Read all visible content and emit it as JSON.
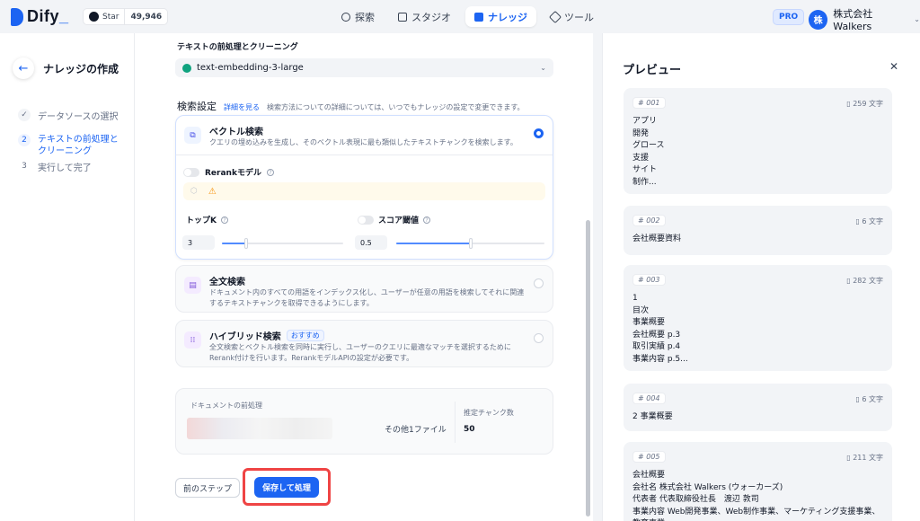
{
  "topbar": {
    "brand": "Dify",
    "github_label": "Star",
    "github_count": "49,946",
    "nav": [
      {
        "label": "探索",
        "icon": "compass-icon"
      },
      {
        "label": "スタジオ",
        "icon": "robot-icon"
      },
      {
        "label": "ナレッジ",
        "icon": "book-icon",
        "active": true
      },
      {
        "label": "ツール",
        "icon": "wrench-icon"
      }
    ],
    "plan_badge": "PRO",
    "avatar_initial": "株",
    "workspace_name": "株式会社Walkers"
  },
  "sidebar": {
    "title": "ナレッジの作成",
    "steps": [
      {
        "num": "✓",
        "label": "データソースの選択",
        "state": "done"
      },
      {
        "num": "2",
        "label": "テキストの前処理とクリーニング",
        "state": "active"
      },
      {
        "num": "3",
        "label": "実行して完了",
        "state": "pending"
      }
    ]
  },
  "main": {
    "section_heading": "テキストの前処理とクリーニング",
    "embedding_model": "text-embedding-3-large",
    "search": {
      "title": "検索設定",
      "link": "詳細を見る",
      "desc": "検索方法についての詳細については、いつでもナレッジの設定で変更できます。"
    },
    "vector": {
      "title": "ベクトル検索",
      "desc": "クエリの埋め込みを生成し、そのベクトル表現に最も類似したテキストチャンクを検索します。",
      "rerank_label": "Rerankモデル",
      "topk_label": "トップK",
      "topk_value": "3",
      "topk_fraction": 0.2,
      "score_label": "スコア閾値",
      "score_value": "0.5",
      "score_fraction": 0.5
    },
    "fulltext": {
      "title": "全文検索",
      "desc": "ドキュメント内のすべての用語をインデックス化し、ユーザーが任意の用語を検索してそれに関連するテキストチャンクを取得できるようにします。"
    },
    "hybrid": {
      "title": "ハイブリッド検索",
      "badge": "おすすめ",
      "desc": "全文検索とベクトル検索を同時に実行し、ユーザーのクエリに最適なマッチを選択するためにRerank付けを行います。RerankモデルAPIの設定が必要です。"
    },
    "preprocess": {
      "label": "ドキュメントの前処理",
      "other_files": "その他1ファイル",
      "chunk_label": "推定チャンク数",
      "chunk_value": "50"
    },
    "prev_button": "前のステップ",
    "save_button": "保存して処理"
  },
  "preview": {
    "title": "プレビュー",
    "chunks": [
      {
        "id": "001",
        "count": "259 文字",
        "text": "アプリ\n開発\nグロース\n支援\nサイト\n制作..."
      },
      {
        "id": "002",
        "count": "6 文字",
        "text": "会社概要資料"
      },
      {
        "id": "003",
        "count": "282 文字",
        "text": "1\n目次\n事業概要\n会社概要 p.3\n取引実績 p.4\n事業内容 p.5..."
      },
      {
        "id": "004",
        "count": "6 文字",
        "text": "2 事業概要"
      },
      {
        "id": "005",
        "count": "211 文字",
        "text": "会社概要\n会社名 株式会社 Walkers (ウォーカーズ)\n代表者 代表取締役社長　渡辺 敦司\n事業内容 Web開発事業、Web制作事業、マーケティング支援事業、教育事業"
      }
    ]
  }
}
